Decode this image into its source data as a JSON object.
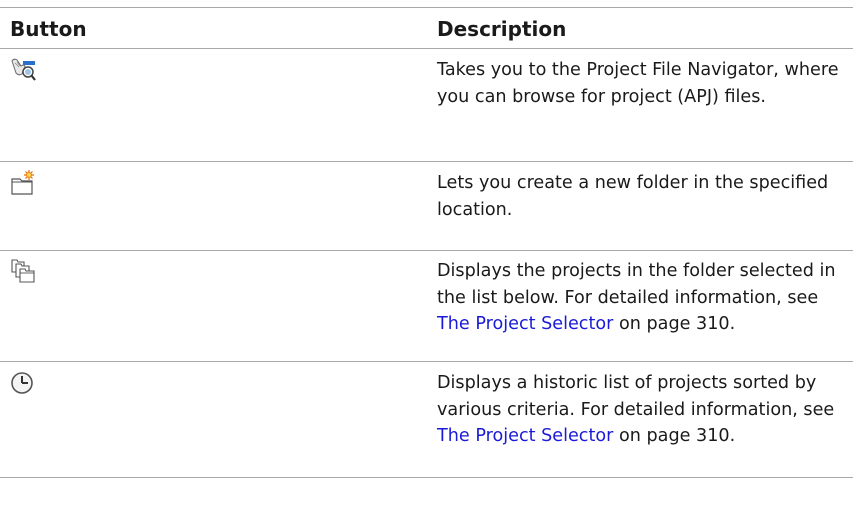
{
  "table": {
    "headers": {
      "button": "Button",
      "description": "Description"
    },
    "rows": [
      {
        "icon": "project-file-navigator-icon",
        "description": "Takes you to the Project File Navigator, where you can browse for project (APJ) files."
      },
      {
        "icon": "new-folder-icon",
        "description": "Lets you create a new folder in the specified location."
      },
      {
        "icon": "projects-in-folder-icon",
        "description_before_link": "Displays the projects in the folder selected in the list below. For detailed information, see ",
        "link_text": "The Project Selector",
        "description_after_link": " on page 310."
      },
      {
        "icon": "history-clock-icon",
        "description_before_link": "Displays a historic list of projects sorted by various criteria. For detailed information, see ",
        "link_text": "The Project Selector",
        "description_after_link": " on page 310."
      }
    ]
  },
  "colors": {
    "link": "#1a1ad8",
    "rule": "#a8a8a8",
    "text": "#1a1a1a"
  }
}
